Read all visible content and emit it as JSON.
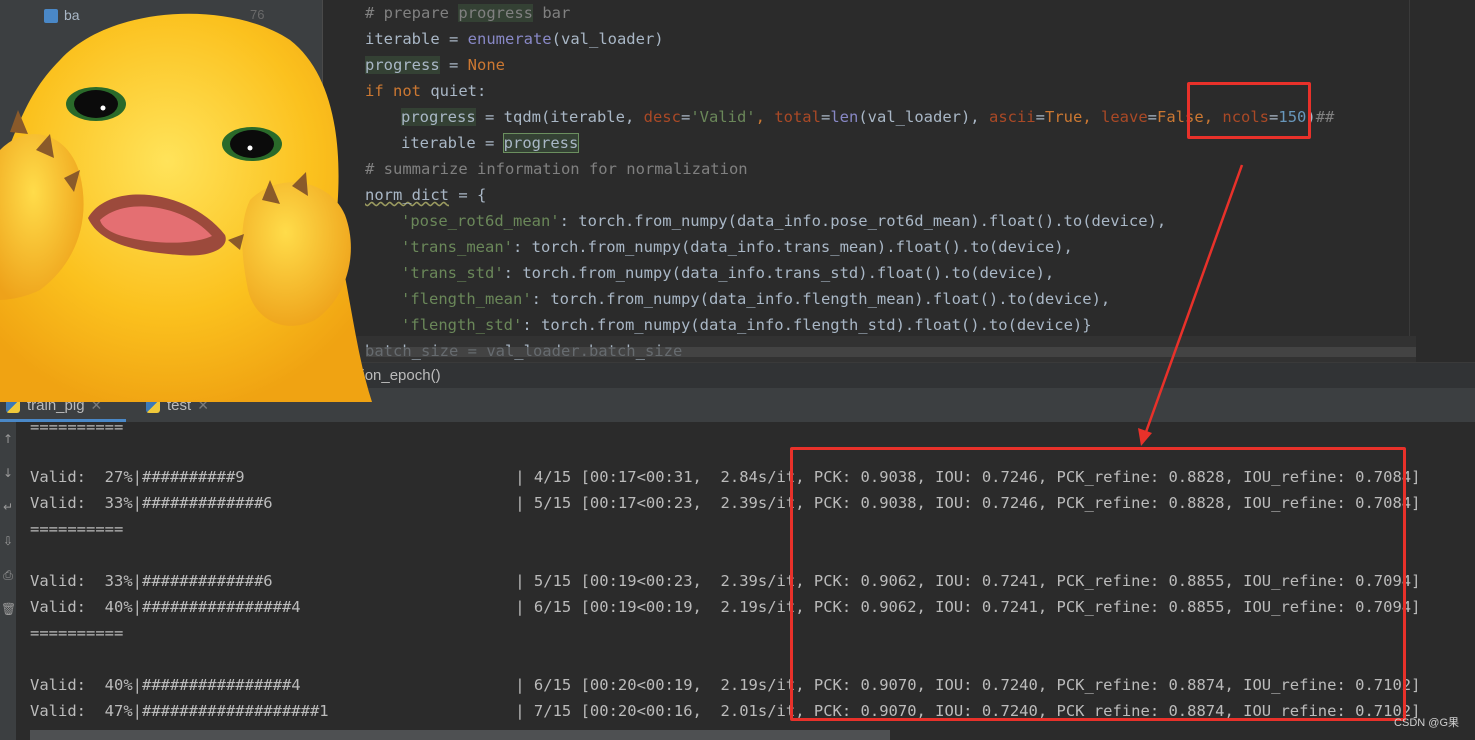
{
  "project_panel": {
    "file_label": "ba",
    "line_count": "76"
  },
  "editor": {
    "lines": {
      "l1": {
        "a": "# prepare ",
        "b": "progress",
        "c": " bar"
      },
      "l2": {
        "a": "iterable = ",
        "b": "enumerate",
        "c": "(val_loader)"
      },
      "l3": {
        "a": "progress",
        "b": " = ",
        "c": "None"
      },
      "l4": {
        "a": "if not",
        "b": " quiet:"
      },
      "l5": {
        "v": "progress",
        "eq": " = tqdm(iterable, ",
        "p1": "desc",
        "e1": "=",
        "s1": "'Valid'",
        "c1": ", ",
        "p2": "total",
        "e2": "=",
        "b2": "len",
        "r2": "(val_loader), ",
        "p3": "ascii",
        "e3": "=",
        "k3": "True",
        "c3": ", ",
        "p4": "leave",
        "e4": "=",
        "k4": "False",
        "c4": ", ",
        "p5": "ncols",
        "e5": "=",
        "n5": "150",
        "r5": ")",
        "t5": "##"
      },
      "l6": {
        "a": "iterable = ",
        "b": "progress"
      },
      "l7": {
        "a": "# summarize information for normalization"
      },
      "l8": {
        "a": "norm_dict",
        "b": " = {"
      },
      "l9": {
        "s": "'pose_rot6d_mean'",
        "r": ": torch.from_numpy(data_info.pose_rot6d_mean).float().to(device),"
      },
      "l10": {
        "s": "'trans_mean'",
        "r": ": torch.from_numpy(data_info.trans_mean).float().to(device),"
      },
      "l11": {
        "s": "'trans_std'",
        "r": ": torch.from_numpy(data_info.trans_std).float().to(device),"
      },
      "l12": {
        "s": "'flength_mean'",
        "r": ": torch.from_numpy(data_info.flength_mean).float().to(device),"
      },
      "l13": {
        "s": "'flength_std'",
        "r": ": torch.from_numpy(data_info.flength_std).float().to(device)}"
      },
      "l14": {
        "a": "batch_size = val_loader.batch_size"
      }
    }
  },
  "breadcrumb": "validation_epoch()",
  "run_tabs": [
    {
      "label": "train_pig"
    },
    {
      "label": "test"
    }
  ],
  "console": {
    "lines": [
      "==========",
      "",
      "Valid:  27%|##########9                             | 4/15 [00:17<00:31,  2.84s/it, PCK: 0.9038, IOU: 0.7246, PCK_refine: 0.8828, IOU_refine: 0.7084]",
      "Valid:  33%|#############6                          | 5/15 [00:17<00:23,  2.39s/it, PCK: 0.9038, IOU: 0.7246, PCK_refine: 0.8828, IOU_refine: 0.7084]",
      "==========",
      "",
      "Valid:  33%|#############6                          | 5/15 [00:19<00:23,  2.39s/it, PCK: 0.9062, IOU: 0.7241, PCK_refine: 0.8855, IOU_refine: 0.7094]",
      "Valid:  40%|################4                       | 6/15 [00:19<00:19,  2.19s/it, PCK: 0.9062, IOU: 0.7241, PCK_refine: 0.8855, IOU_refine: 0.7094]",
      "==========",
      "",
      "Valid:  40%|################4                       | 6/15 [00:20<00:19,  2.19s/it, PCK: 0.9070, IOU: 0.7240, PCK_refine: 0.8874, IOU_refine: 0.7102]",
      "Valid:  47%|###################1                    | 7/15 [00:20<00:16,  2.01s/it, PCK: 0.9070, IOU: 0.7240, PCK_refine: 0.8874, IOU_refine: 0.7102]"
    ]
  },
  "watermark": "CSDN @G果",
  "colors": {
    "annotation": "#e8312a",
    "keyword": "#cc7832",
    "string": "#6a8759",
    "comment": "#808080",
    "param": "#aa4926",
    "number": "#6897bb"
  }
}
